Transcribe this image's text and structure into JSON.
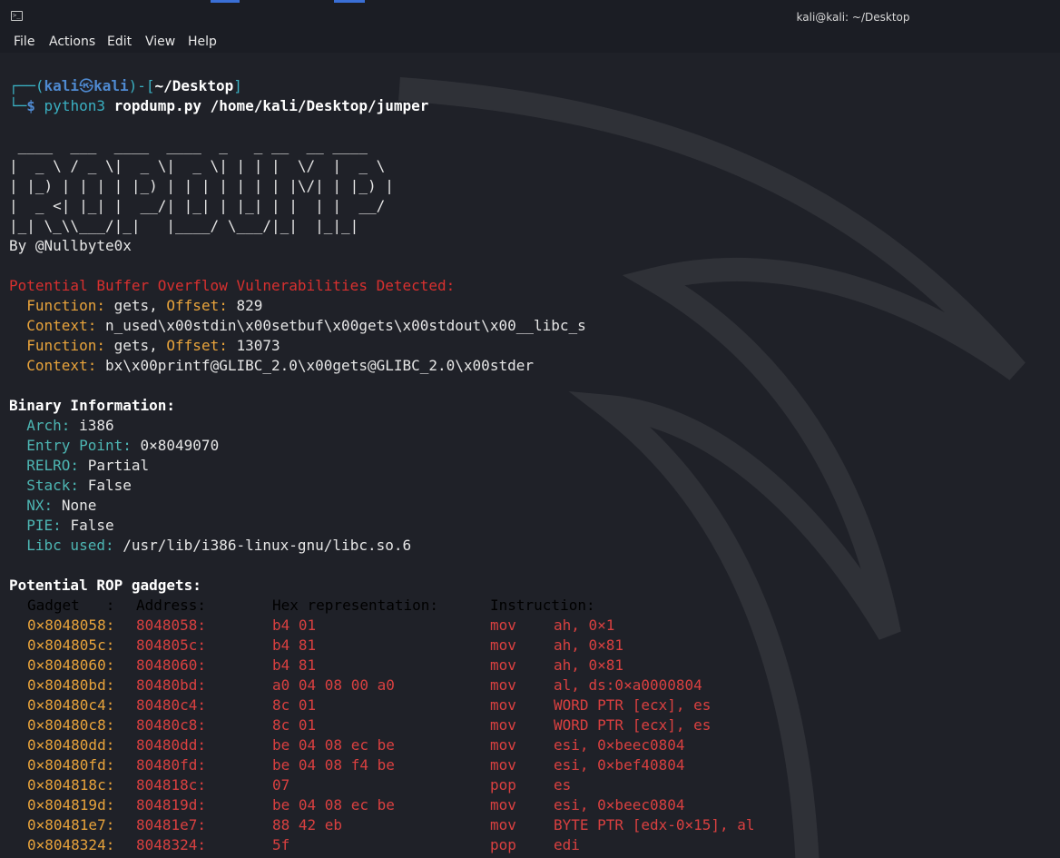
{
  "window": {
    "title": "kali@kali: ~/Desktop",
    "menu": [
      "File",
      "Actions",
      "Edit",
      "View",
      "Help"
    ]
  },
  "prompt": {
    "open": "┌──(",
    "user": "kali",
    "at": "㉿",
    "host": "kali",
    "mid": ")-[",
    "path": "~/Desktop",
    "close": "]",
    "corner": "└─",
    "dollar": "$",
    "command": "python3",
    "args": "ropdump.py /home/kali/Desktop/jumper"
  },
  "banner": {
    "ascii": [
      " ____  ___  ____  ____  _   _ __  __ ____  ",
      "|  _ \\ / _ \\|  _ \\|  _ \\| | | |  \\/  |  _ \\ ",
      "| |_) | | | | |_) | | | | | | | |\\/| | |_) |",
      "|  _ <| |_| |  __/| |_| | |_| | |  | |  __/ ",
      "|_| \\_\\\\___/|_|   |____/ \\___/|_|  |_|_|    "
    ],
    "author": "By @Nullbyte0x"
  },
  "vulns": {
    "heading": "Potential Buffer Overflow Vulnerabilities Detected:",
    "items": [
      {
        "func_label": "Function:",
        "func": "gets",
        "off_label": "Offset:",
        "offset": "829",
        "ctx_label": "Context:",
        "context": "n_used\\x00stdin\\x00setbuf\\x00gets\\x00stdout\\x00__libc_s"
      },
      {
        "func_label": "Function:",
        "func": "gets",
        "off_label": "Offset:",
        "offset": "13073",
        "ctx_label": "Context:",
        "context": "bx\\x00printf@GLIBC_2.0\\x00gets@GLIBC_2.0\\x00stder"
      }
    ]
  },
  "binary": {
    "heading": "Binary Information:",
    "fields": [
      {
        "label": "Arch:",
        "value": "i386"
      },
      {
        "label": "Entry Point:",
        "value": "0×8049070"
      },
      {
        "label": "RELRO:",
        "value": "Partial"
      },
      {
        "label": "Stack:",
        "value": "False"
      },
      {
        "label": "NX:",
        "value": "None"
      },
      {
        "label": "PIE:",
        "value": "False"
      },
      {
        "label": "Libc used:",
        "value": "/usr/lib/i386-linux-gnu/libc.so.6"
      }
    ]
  },
  "rop": {
    "heading": "Potential ROP gadgets:",
    "headers": [
      "Gadget   :",
      "Address:",
      "Hex representation:",
      "Instruction:"
    ],
    "rows": [
      [
        "0×8048058:",
        "8048058:",
        "b4 01",
        "mov",
        "ah, 0×1"
      ],
      [
        "0×804805c:",
        "804805c:",
        "b4 81",
        "mov",
        "ah, 0×81"
      ],
      [
        "0×8048060:",
        "8048060:",
        "b4 81",
        "mov",
        "ah, 0×81"
      ],
      [
        "0×80480bd:",
        "80480bd:",
        "a0 04 08 00 a0",
        "mov",
        "al, ds:0×a0000804"
      ],
      [
        "0×80480c4:",
        "80480c4:",
        "8c 01",
        "mov",
        "WORD PTR [ecx], es"
      ],
      [
        "0×80480c8:",
        "80480c8:",
        "8c 01",
        "mov",
        "WORD PTR [ecx], es"
      ],
      [
        "0×80480dd:",
        "80480dd:",
        "be 04 08 ec be",
        "mov",
        "esi, 0×beec0804"
      ],
      [
        "0×80480fd:",
        "80480fd:",
        "be 04 08 f4 be",
        "mov",
        "esi, 0×bef40804"
      ],
      [
        "0×804818c:",
        "804818c:",
        "07",
        "pop",
        "es"
      ],
      [
        "0×804819d:",
        "804819d:",
        "be 04 08 ec be",
        "mov",
        "esi, 0×beec0804"
      ],
      [
        "0×80481e7:",
        "80481e7:",
        "88 42 eb",
        "mov",
        "BYTE PTR [edx-0×15], al"
      ],
      [
        "0×8048324:",
        "8048324:",
        "5f",
        "pop",
        "edi"
      ]
    ]
  }
}
